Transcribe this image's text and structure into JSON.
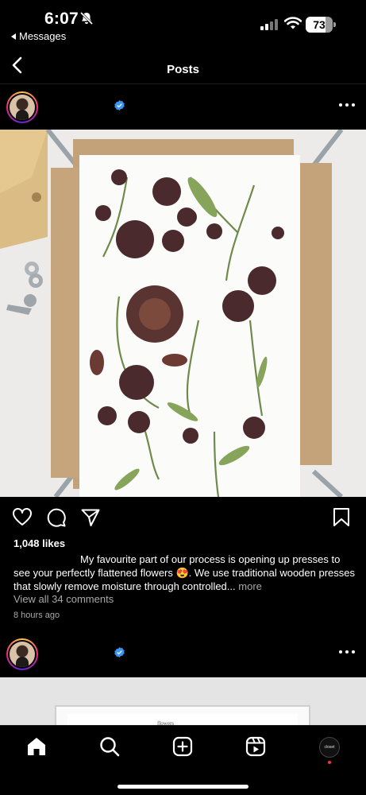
{
  "status_bar": {
    "time": "6:07",
    "back_app": "Messages",
    "battery": "73",
    "battery_level": 0.73
  },
  "header": {
    "title": "Posts"
  },
  "post": {
    "likes": "1,048 likes",
    "caption": "My favourite part of our process is opening up presses to see your perfectly flattened flowers 😍. We use traditional wooden presses that slowly remove moisture through controlled...",
    "more_label": "more",
    "view_comments": "View all 34 comments",
    "time_ago": "8 hours ago"
  },
  "post2": {
    "partial_text": "flowers"
  },
  "nav": {
    "profile_label": "closet"
  },
  "icons": [
    "bell-slash-icon",
    "signal-icon",
    "wifi-icon",
    "back-arrow-icon",
    "verified-icon",
    "more-icon",
    "heart-icon",
    "comment-icon",
    "share-icon",
    "bookmark-icon",
    "home-icon",
    "search-icon",
    "create-icon",
    "reels-icon"
  ],
  "colors": {
    "background": "#000000",
    "verified": "#3897f0",
    "muted_text": "#a8a8a8",
    "notification_dot": "#ff3040"
  }
}
